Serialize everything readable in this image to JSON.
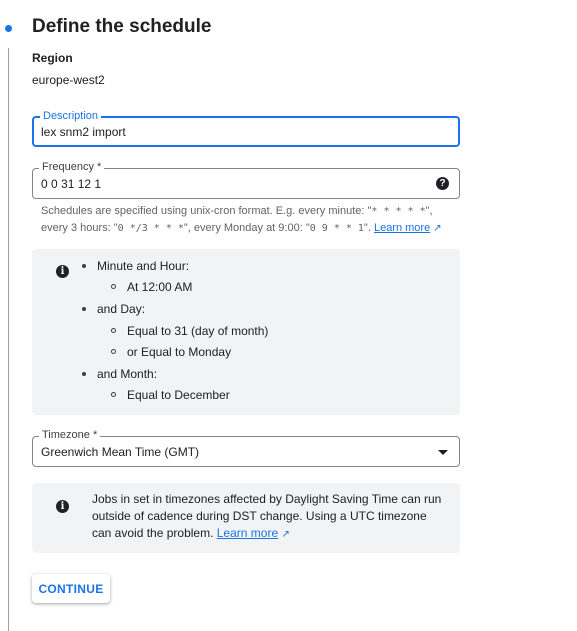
{
  "step": {
    "title": "Define the schedule"
  },
  "region": {
    "label": "Region",
    "value": "europe-west2"
  },
  "description": {
    "label": "Description",
    "value": "lex snm2 import"
  },
  "frequency": {
    "label": "Frequency *",
    "value": "0 0 31 12 1",
    "help_icon": "question-circle-icon",
    "hint_prefix": "Schedules are specified using unix-cron format. E.g. every minute: \"",
    "hint_ex1": "* * * * *",
    "hint_mid1": "\", every 3 hours: \"",
    "hint_ex2": "0 */3 * * *",
    "hint_mid2": "\", every Monday at 9:00: \"",
    "hint_ex3": "0 9 * * 1",
    "hint_suffix": "\".",
    "learn_more": "Learn more"
  },
  "schedule_summary": {
    "icon": "info-icon",
    "minute_hour": "Minute and Hour:",
    "at_time": "At 12:00 AM",
    "and_day": "and Day:",
    "day_of_month": "Equal to 31 (day of month)",
    "or_day": "or Equal to Monday",
    "and_month": "and Month:",
    "month": "Equal to December"
  },
  "timezone": {
    "label": "Timezone *",
    "value": "Greenwich Mean Time (GMT)",
    "dropdown_icon": "caret-down-icon"
  },
  "dst_notice": {
    "icon": "info-icon",
    "text": "Jobs in set in timezones affected by Daylight Saving Time can run outside of cadence during DST change. Using a UTC timezone can avoid the problem.",
    "learn_more": "Learn more"
  },
  "actions": {
    "continue": "CONTINUE"
  },
  "colors": {
    "accent": "#1a73e8",
    "info_bg": "#f1f3f4"
  }
}
